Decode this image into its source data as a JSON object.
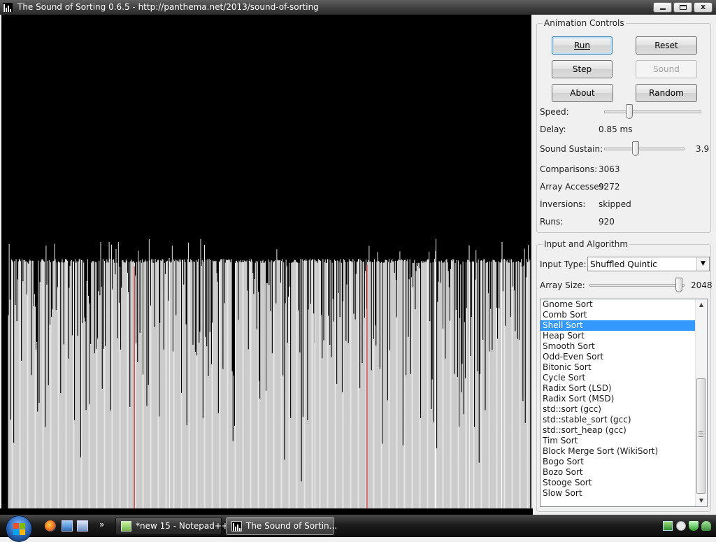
{
  "window": {
    "title": "The Sound of Sorting 0.6.5 - http://panthema.net/2013/sound-of-sorting",
    "controls": {
      "minimize": "minimize",
      "maximize": "maximize",
      "close": "x"
    }
  },
  "visualization": {
    "background": "#000000",
    "bar_color": "#ffffff",
    "highlight_color": "#cc1f1f",
    "array_size": 2048
  },
  "animation_controls": {
    "legend": "Animation Controls",
    "buttons": {
      "run": "Run",
      "reset": "Reset",
      "step": "Step",
      "sound": "Sound",
      "about": "About",
      "random": "Random"
    },
    "speed": {
      "label": "Speed:",
      "level": 0.24
    },
    "delay": {
      "label": "Delay:",
      "value": "0.85 ms"
    },
    "sound_sustain": {
      "label": "Sound Sustain:",
      "value": "3.9",
      "level": 0.38
    },
    "stats": [
      {
        "label": "Comparisons:",
        "value": "3063"
      },
      {
        "label": "Array Accesses:",
        "value": "9272"
      },
      {
        "label": "Inversions:",
        "value": "skipped"
      },
      {
        "label": "Runs:",
        "value": "920"
      }
    ]
  },
  "input_algorithm": {
    "legend": "Input and Algorithm",
    "input_type_label": "Input Type:",
    "input_type_value": "Shuffled Quintic",
    "array_size_label": "Array Size:",
    "array_size_value": "2048",
    "array_size_level": 0.98,
    "selected": "Shell Sort",
    "algorithms": [
      "Gnome Sort",
      "Comb Sort",
      "Shell Sort",
      "Heap Sort",
      "Smooth Sort",
      "Odd-Even Sort",
      "Bitonic Sort",
      "Cycle Sort",
      "Radix Sort (LSD)",
      "Radix Sort (MSD)",
      "std::sort (gcc)",
      "std::stable_sort (gcc)",
      "std::sort_heap (gcc)",
      "Tim Sort",
      "Block Merge Sort (WikiSort)",
      "Bogo Sort",
      "Bozo Sort",
      "Stooge Sort",
      "Slow Sort"
    ]
  },
  "taskbar": {
    "start": "start-orb",
    "quick_launch": [
      "firefox-icon",
      "show-desktop-icon",
      "switch-windows-icon"
    ],
    "overflow": "»",
    "tasks": [
      {
        "label": "*new 15 - Notepad++",
        "active": false
      },
      {
        "label": "The Sound of Sortin...",
        "active": true
      }
    ],
    "tray": [
      "network-icon",
      "chat-icon",
      "security-shield-icon",
      "user-status-icon"
    ]
  }
}
